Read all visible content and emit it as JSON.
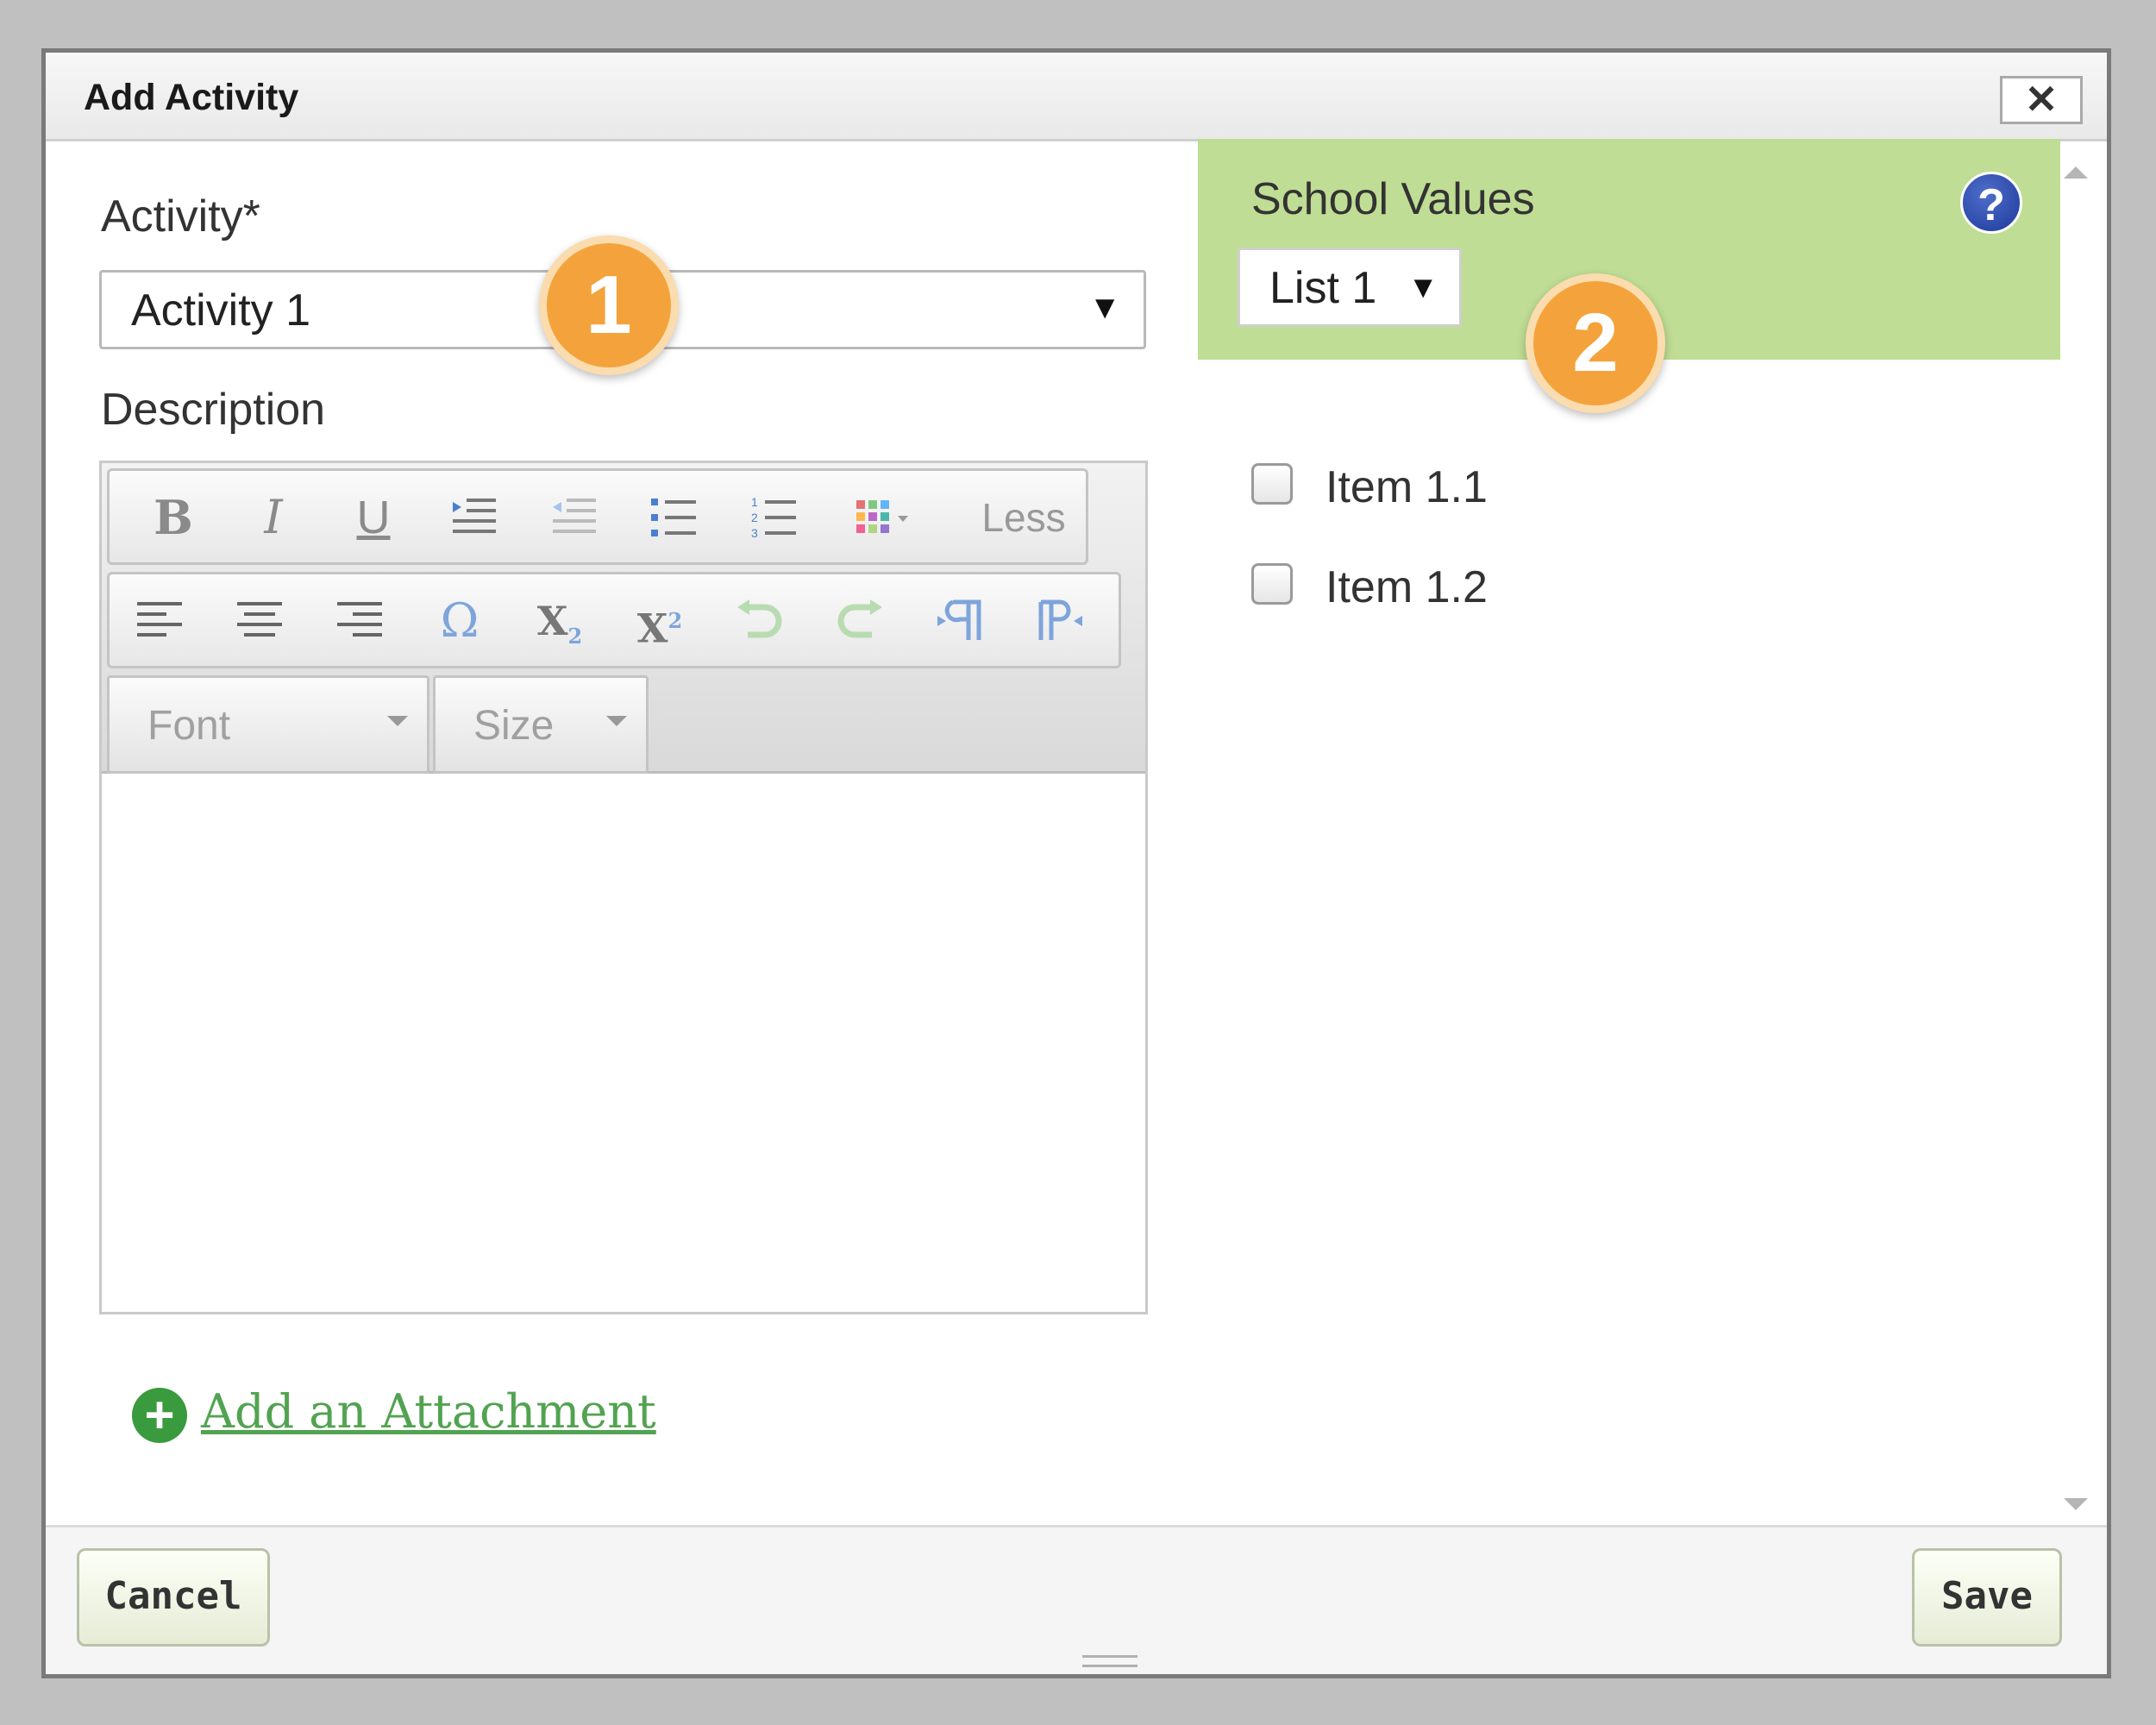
{
  "dialog": {
    "title": "Add Activity",
    "close_symbol": "✕"
  },
  "form": {
    "activity_label": "Activity*",
    "activity_value": "Activity 1",
    "description_label": "Description"
  },
  "editor_toolbar": {
    "less_label": "Less",
    "font_label": "Font",
    "size_label": "Size",
    "buttons_row1": [
      "bold-icon",
      "italic-icon",
      "underline-icon",
      "indent-icon",
      "outdent-icon",
      "bullet-list-icon",
      "numbered-list-icon",
      "color-grid-icon"
    ],
    "buttons_row2": [
      "align-left-icon",
      "align-center-icon",
      "align-right-icon",
      "omega-icon",
      "subscript-icon",
      "superscript-icon",
      "undo-icon",
      "redo-icon",
      "ltr-icon",
      "rtl-icon"
    ]
  },
  "attachment": {
    "link_text": "Add an Attachment"
  },
  "school_values": {
    "title": "School Values",
    "list_value": "List 1",
    "items": [
      "Item 1.1",
      "Item 1.2"
    ]
  },
  "footer": {
    "cancel_label": "Cancel",
    "save_label": "Save"
  },
  "markers": [
    "1",
    "2"
  ],
  "colors": {
    "accent_green": "#bfdd94",
    "marker_orange": "#f4a33c",
    "help_blue": "#1d3a9b",
    "link_green": "#52a351"
  }
}
